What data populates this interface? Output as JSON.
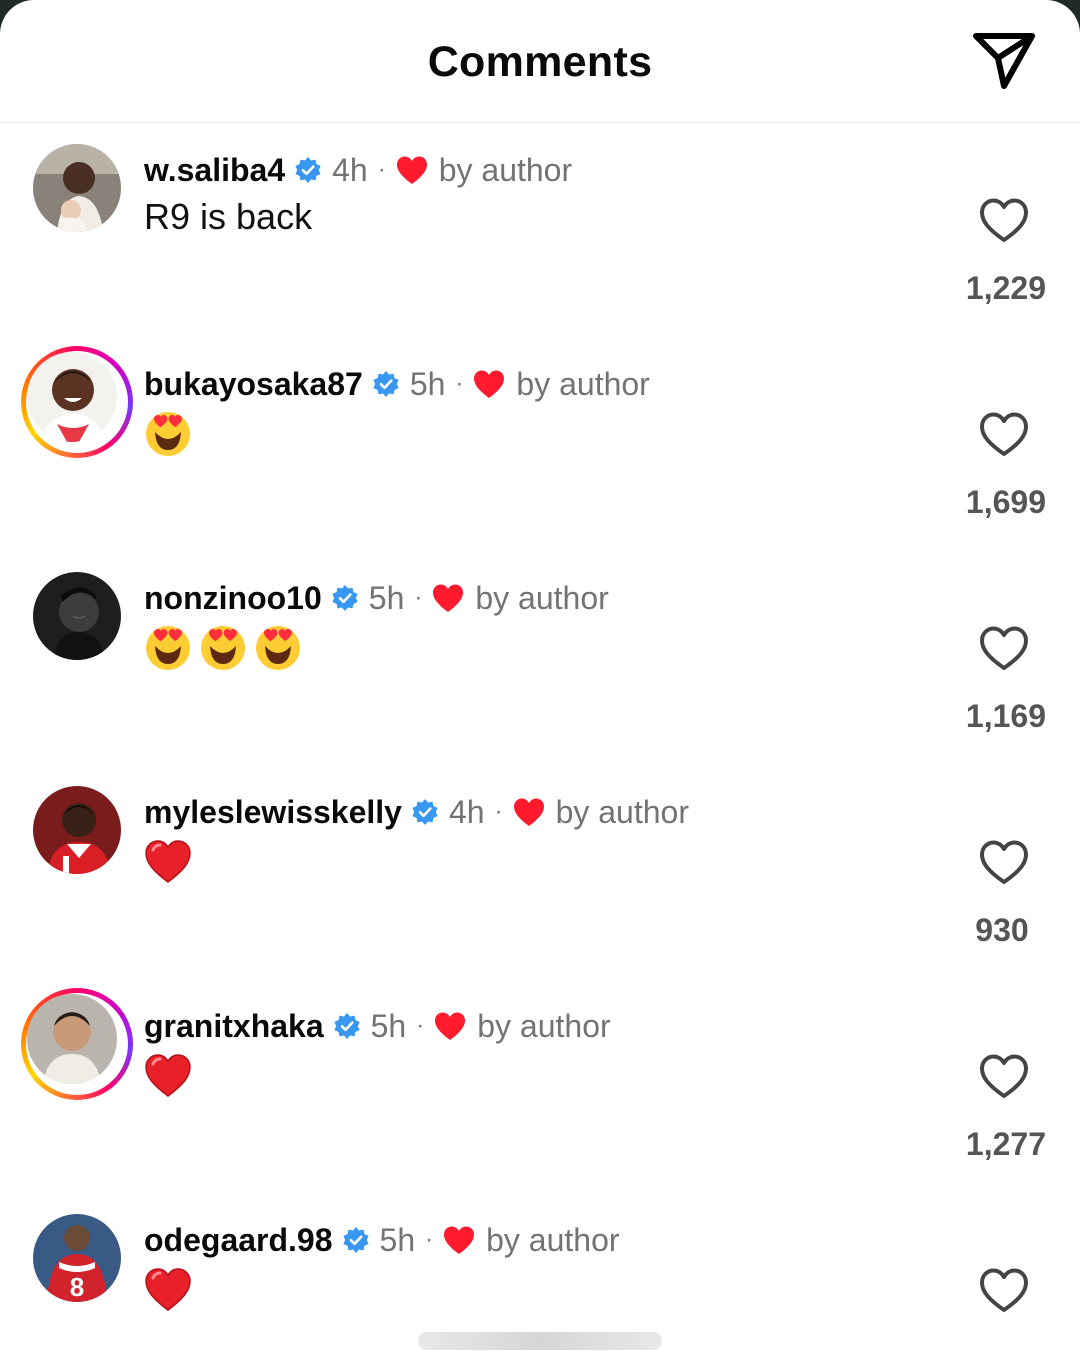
{
  "header": {
    "title": "Comments",
    "share_icon": "send-icon"
  },
  "colors": {
    "verified": "#3897f0",
    "heart": "#ff2d3d",
    "muted": "#737373"
  },
  "comments": [
    {
      "username": "w.saliba4",
      "time": "4h",
      "dot": "·",
      "liked_by": "by author",
      "text": "R9 is back",
      "likes": "1,229",
      "story_ring": false
    },
    {
      "username": "bukayosaka87",
      "time": "5h",
      "dot": "·",
      "liked_by": "by author",
      "emojis": [
        "heart-eyes"
      ],
      "likes": "1,699",
      "story_ring": true
    },
    {
      "username": "nonzinoo10",
      "time": "5h",
      "dot": "·",
      "liked_by": "by author",
      "emojis": [
        "heart-eyes",
        "heart-eyes",
        "heart-eyes"
      ],
      "likes": "1,169",
      "story_ring": false
    },
    {
      "username": "myleslewisskelly",
      "time": "4h",
      "dot": "·",
      "liked_by": "by author",
      "emojis": [
        "red-heart"
      ],
      "likes": "930",
      "story_ring": false
    },
    {
      "username": "granitxhaka",
      "time": "5h",
      "dot": "·",
      "liked_by": "by author",
      "emojis": [
        "red-heart"
      ],
      "likes": "1,277",
      "story_ring": true
    },
    {
      "username": "odegaard.98",
      "time": "5h",
      "dot": "·",
      "liked_by": "by author",
      "emojis": [
        "red-heart"
      ],
      "likes": "",
      "story_ring": false
    }
  ]
}
